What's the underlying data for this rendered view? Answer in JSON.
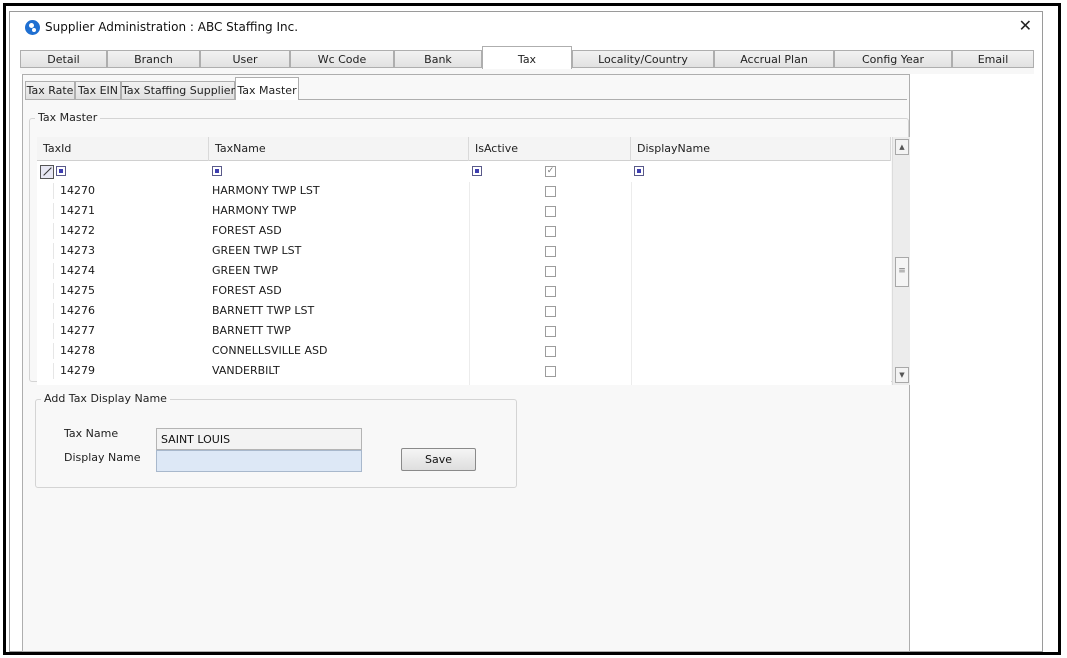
{
  "window": {
    "title": "Supplier Administration : ABC Staffing Inc.",
    "close_glyph": "✕"
  },
  "main_tabs": [
    {
      "label": "Detail"
    },
    {
      "label": "Branch"
    },
    {
      "label": "User"
    },
    {
      "label": "Wc Code"
    },
    {
      "label": "Bank"
    },
    {
      "label": "Tax"
    },
    {
      "label": "Locality/Country"
    },
    {
      "label": "Accrual Plan"
    },
    {
      "label": "Config Year"
    },
    {
      "label": "Email"
    }
  ],
  "sub_tabs": [
    {
      "label": "Tax Rate"
    },
    {
      "label": "Tax EIN"
    },
    {
      "label": "Tax Staffing Supplier"
    },
    {
      "label": "Tax Master"
    }
  ],
  "tax_master": {
    "group_label": "Tax Master",
    "columns": [
      "TaxId",
      "TaxName",
      "IsActive",
      "DisplayName"
    ],
    "header_checkbox_glyph": "✓",
    "rows": [
      {
        "id": "14270",
        "name": "HARMONY TWP LST",
        "active": false
      },
      {
        "id": "14271",
        "name": "HARMONY TWP",
        "active": false
      },
      {
        "id": "14272",
        "name": "FOREST ASD",
        "active": false
      },
      {
        "id": "14273",
        "name": "GREEN TWP LST",
        "active": false
      },
      {
        "id": "14274",
        "name": "GREEN TWP",
        "active": false
      },
      {
        "id": "14275",
        "name": "FOREST ASD",
        "active": false
      },
      {
        "id": "14276",
        "name": "BARNETT TWP LST",
        "active": false
      },
      {
        "id": "14277",
        "name": "BARNETT TWP",
        "active": false
      },
      {
        "id": "14278",
        "name": "CONNELLSVILLE ASD",
        "active": false
      },
      {
        "id": "14279",
        "name": "VANDERBILT",
        "active": false
      }
    ],
    "scroll_up_glyph": "▲",
    "scroll_down_glyph": "▼",
    "scroll_thumb_glyph": "≡"
  },
  "add_display": {
    "group_label": "Add Tax Display Name",
    "tax_name_label": "Tax Name",
    "tax_name_value": "SAINT LOUIS",
    "display_name_label": "Display Name",
    "display_name_value": "",
    "save_label": "Save"
  },
  "colors": {
    "selection_blue": "#dde8f6",
    "accent": "#1f6fd1"
  }
}
